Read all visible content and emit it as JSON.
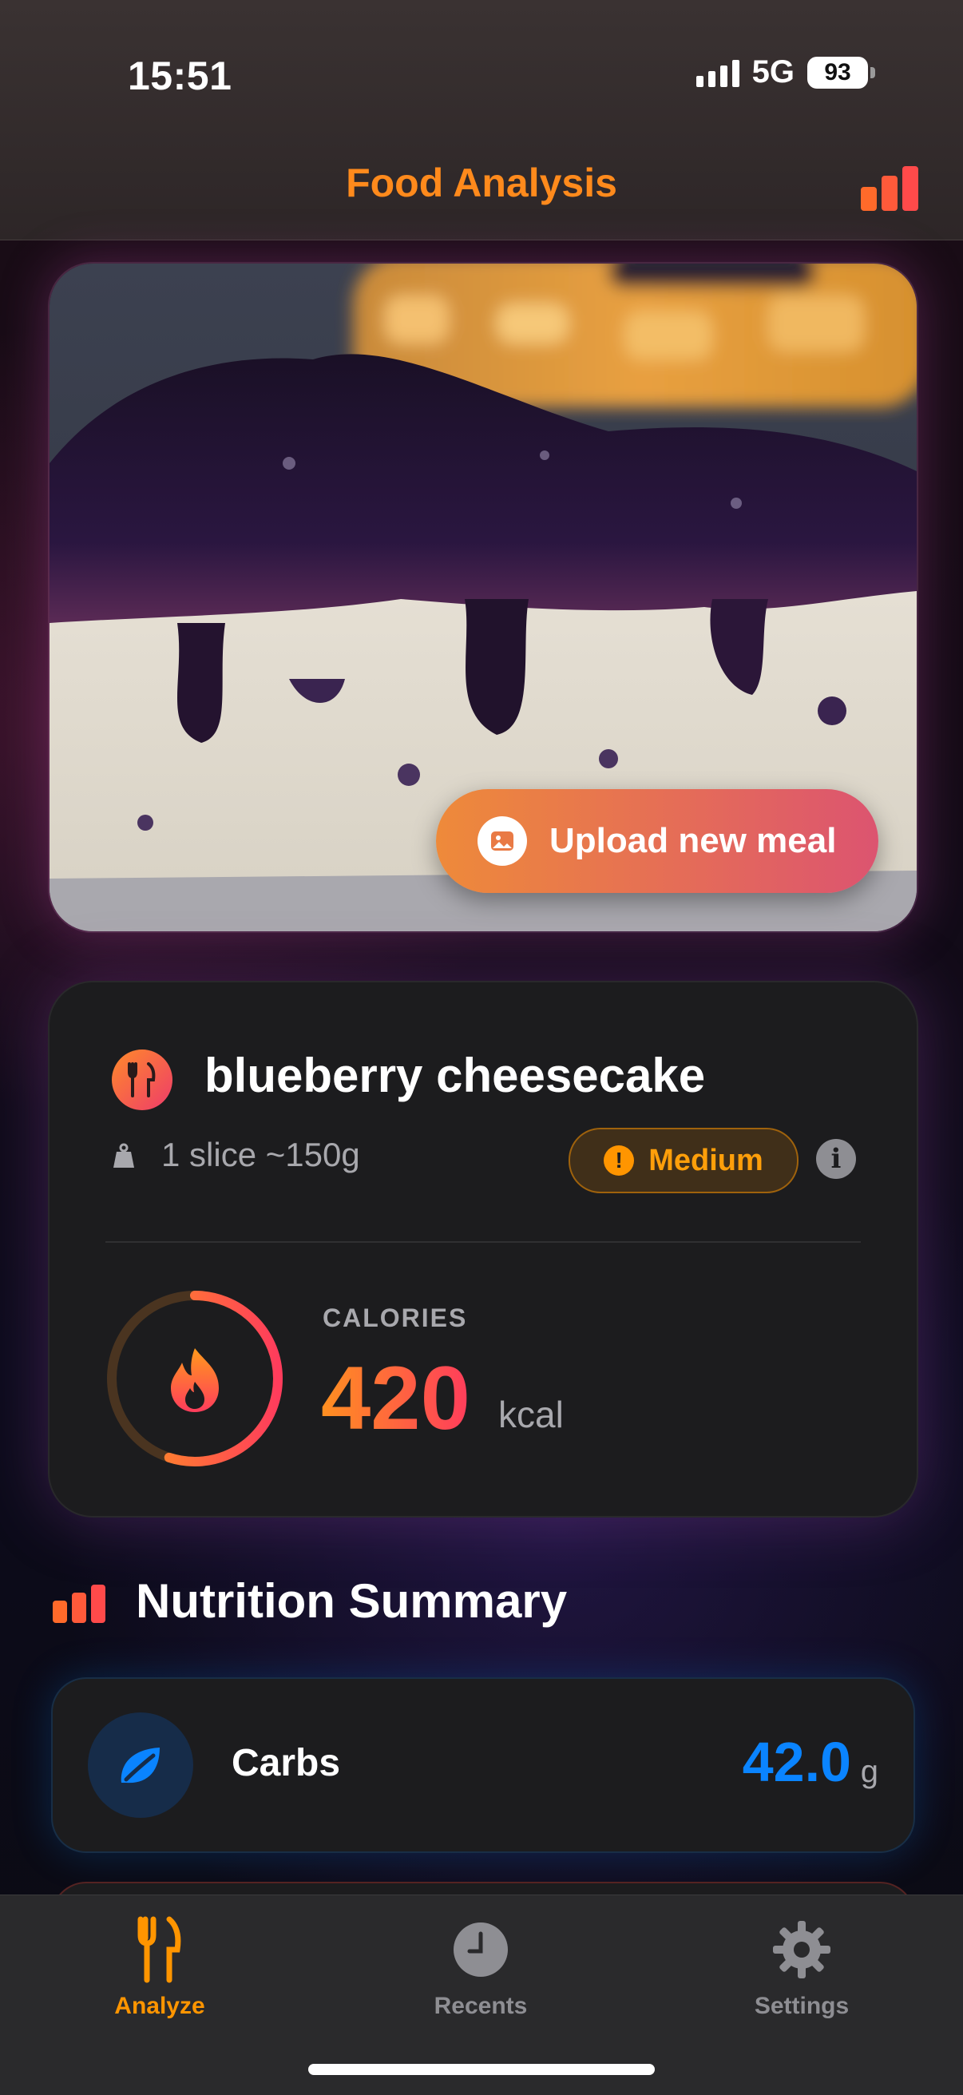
{
  "status_bar": {
    "time": "15:51",
    "network": "5G",
    "battery": "93"
  },
  "header": {
    "title": "Food Analysis",
    "chart_icon": "bar-chart-icon",
    "accent_color": "#ff8a1c"
  },
  "hero": {
    "upload_label": "Upload new meal",
    "upload_icon": "photo-icon"
  },
  "food": {
    "name": "blueberry cheesecake",
    "portion": "1 slice ~150g",
    "confidence": "Medium",
    "confidence_icon": "exclamation-icon",
    "info_icon": "info-icon",
    "calories_label": "CALORIES",
    "calories_value": "420",
    "calories_unit": "kcal",
    "calorie_ring_fraction": 0.55
  },
  "nutrition": {
    "title": "Nutrition Summary",
    "items": [
      {
        "label": "Carbs",
        "value": "42.0",
        "unit": "g",
        "icon": "leaf-icon",
        "color": "#0a84ff"
      }
    ]
  },
  "tabs": [
    {
      "label": "Analyze",
      "icon": "fork-knife-icon",
      "active": true
    },
    {
      "label": "Recents",
      "icon": "clock-icon",
      "active": false
    },
    {
      "label": "Settings",
      "icon": "gear-icon",
      "active": false
    }
  ],
  "colors": {
    "orange": "#ff9500",
    "blue": "#0a84ff",
    "card": "#1c1c1e",
    "muted": "#a8a8ad"
  }
}
